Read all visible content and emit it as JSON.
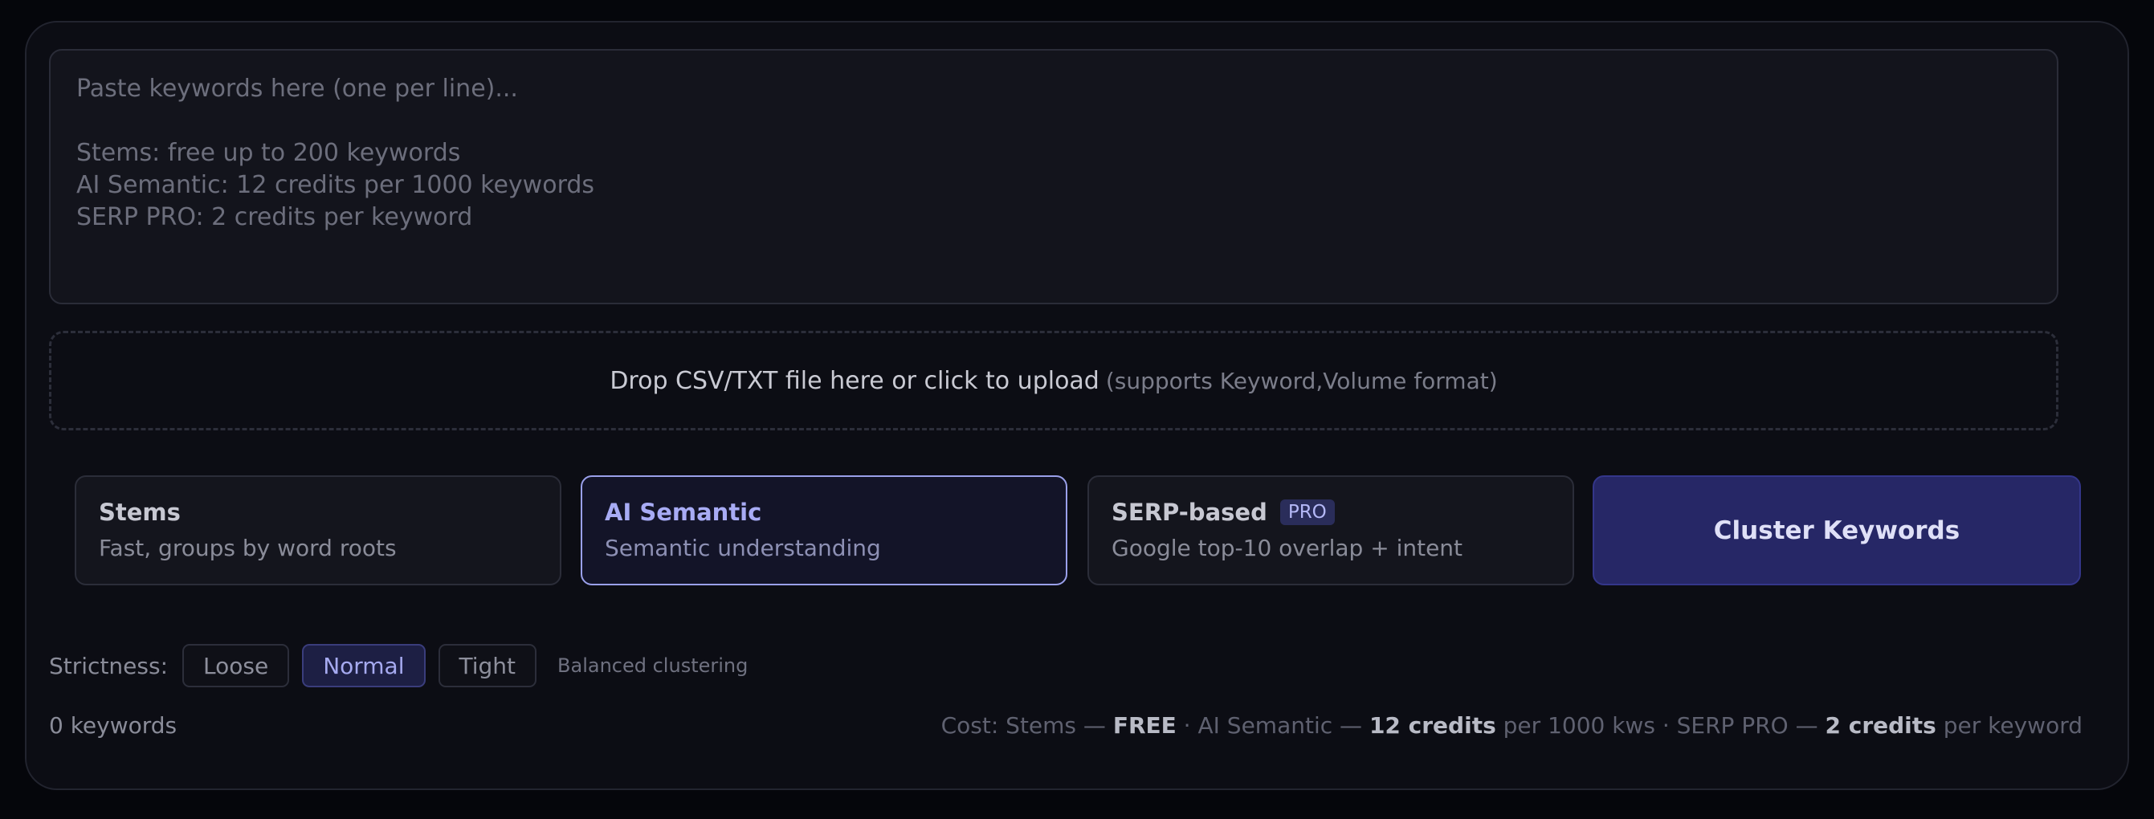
{
  "input": {
    "placeholder": "Paste keywords here (one per line)...\n\nStems: free up to 200 keywords\nAI Semantic: 12 credits per 1000 keywords\nSERP PRO: 2 credits per keyword"
  },
  "upload": {
    "label": "Drop CSV/TXT file here or click to upload",
    "hint": "(supports Keyword,Volume format)"
  },
  "modes": [
    {
      "title": "Stems",
      "desc": "Fast, groups by word roots",
      "selected": false
    },
    {
      "title": "AI Semantic",
      "desc": "Semantic understanding",
      "selected": true
    },
    {
      "title": "SERP-based",
      "badge": "PRO",
      "desc": "Google top-10 overlap + intent",
      "selected": false
    }
  ],
  "cluster_button": "Cluster Keywords",
  "strictness": {
    "label": "Strictness:",
    "options": [
      "Loose",
      "Normal",
      "Tight"
    ],
    "selected": "Normal",
    "note": "Balanced clustering"
  },
  "footer": {
    "keyword_count": "0 keywords",
    "cost": {
      "prefix": "Cost: Stems — ",
      "stems_price": "FREE",
      "sep1": " · AI Semantic — ",
      "semantic_price": "12 credits",
      "semantic_unit": " per 1000 kws · SERP PRO — ",
      "serp_price": "2 credits",
      "serp_unit": " per keyword"
    }
  },
  "colors": {
    "accent": "#9aa0ea",
    "button_bg": "#262766",
    "panel_bg": "#0c0d14"
  }
}
